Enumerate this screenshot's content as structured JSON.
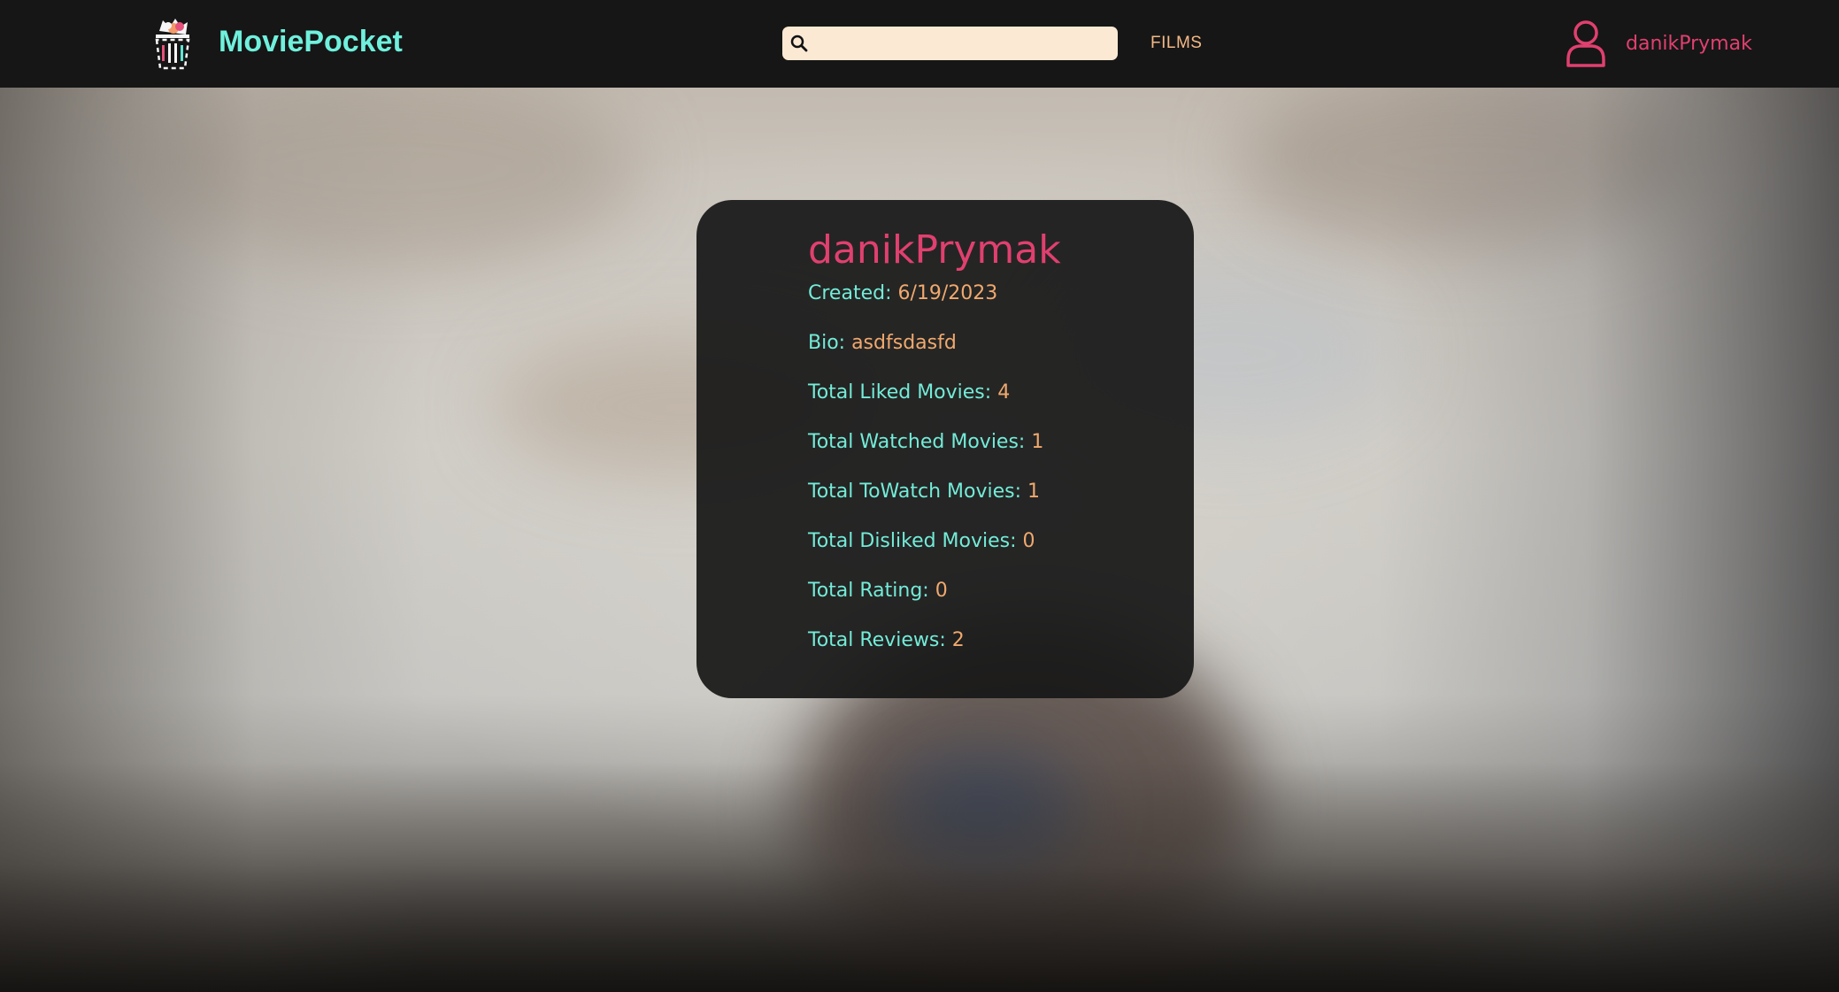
{
  "header": {
    "brand": "MoviePocket",
    "search": {
      "placeholder": "",
      "value": ""
    },
    "nav": {
      "films": "FILMS"
    },
    "user": {
      "name": "danikPrymak"
    }
  },
  "profile": {
    "username": "danikPrymak",
    "created": {
      "label": "Created:",
      "value": "6/19/2023"
    },
    "bio": {
      "label": "Bio:",
      "value": "asdfsdasfd"
    },
    "liked": {
      "label": "Total Liked Movies:",
      "value": "4"
    },
    "watched": {
      "label": "Total Watched Movies:",
      "value": "1"
    },
    "towatch": {
      "label": "Total ToWatch Movies:",
      "value": "1"
    },
    "disliked": {
      "label": "Total Disliked Movies:",
      "value": "0"
    },
    "rating": {
      "label": "Total Rating:",
      "value": "0"
    },
    "reviews": {
      "label": "Total Reviews:",
      "value": "2"
    }
  },
  "icons": {
    "logo": "popcorn-film-icon",
    "search": "search-icon",
    "user": "user-icon"
  },
  "colors": {
    "header_bg": "#161616",
    "brand": "#6ff0dc",
    "accent_pink": "#e0406f",
    "label_teal": "#73ecd8",
    "value_orange": "#f0a96e",
    "search_bg": "#fbe9d4",
    "films_link": "#f4b987",
    "card_bg": "#181818"
  }
}
